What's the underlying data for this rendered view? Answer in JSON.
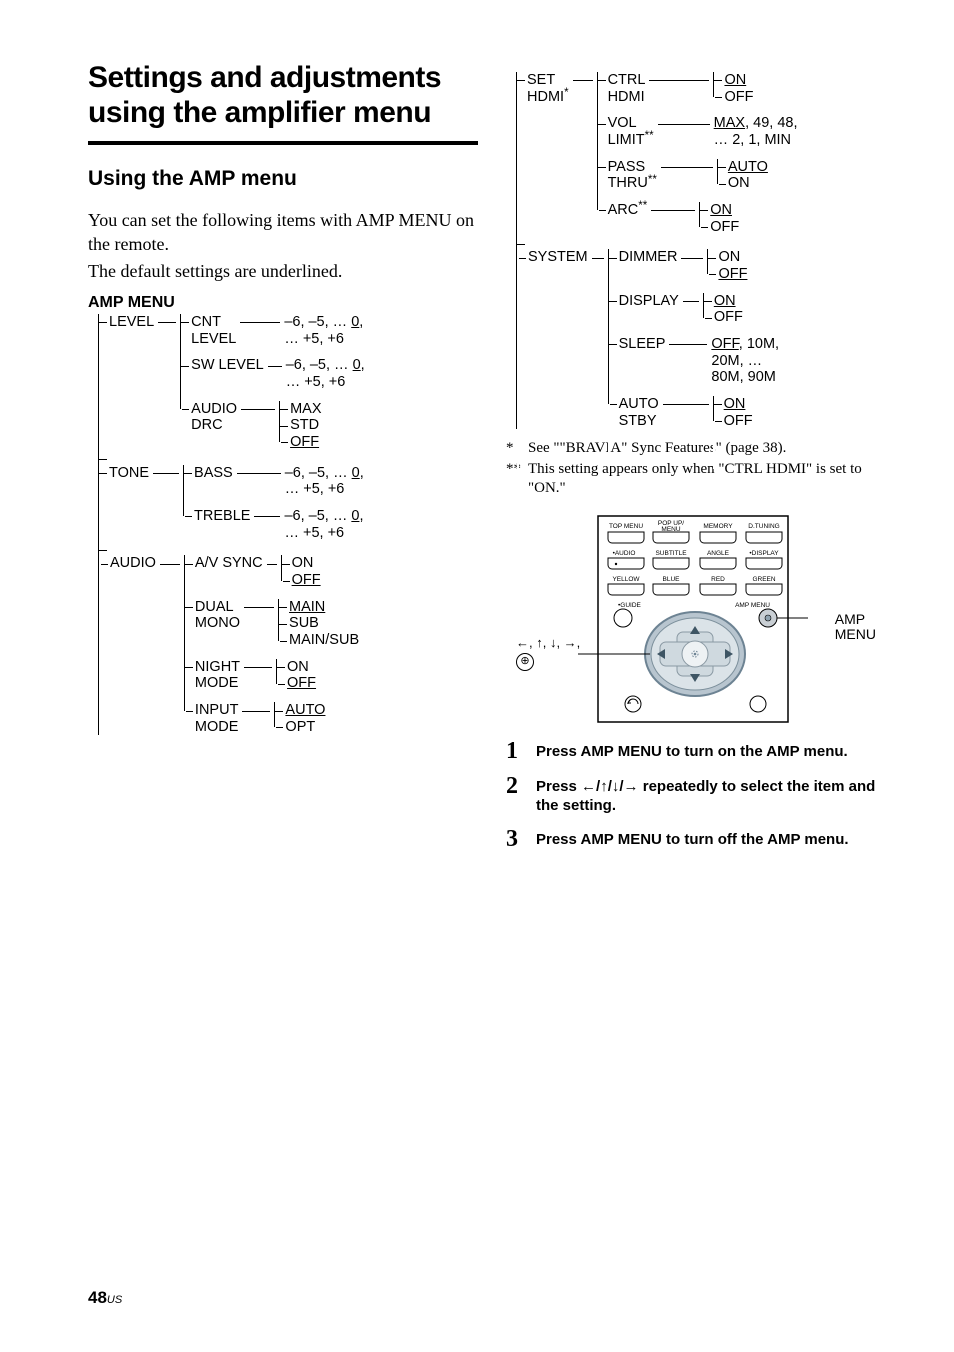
{
  "section_title_l1": "Settings and adjustments",
  "section_title_l2": "using the amplifier menu",
  "subhead": "Using the AMP menu",
  "intro_l1": "You can set the following items with AMP MENU on the remote.",
  "intro_l2": "The default settings are underlined.",
  "amp_menu_label": "AMP MENU",
  "tree": {
    "level": {
      "label": "LEVEL",
      "cnt_level_label": "CNT LEVEL",
      "cnt_level_values": "–6, –5, … 0, … +5, +6",
      "sw_level_label": "SW LEVEL",
      "sw_level_values": "–6, –5, … 0, … +5, +6",
      "audio_drc_label": "AUDIO DRC",
      "audio_drc_v_max": "MAX",
      "audio_drc_v_std": "STD",
      "audio_drc_v_off": "OFF"
    },
    "tone": {
      "label": "TONE",
      "bass_label": "BASS",
      "bass_values": "–6, –5, … 0, … +5, +6",
      "treble_label": "TREBLE",
      "treble_values": "–6, –5, … 0, … +5, +6"
    },
    "audio": {
      "label": "AUDIO",
      "av_sync_label": "A/V SYNC",
      "av_sync_on": "ON",
      "av_sync_off": "OFF",
      "dual_mono_label": "DUAL MONO",
      "dual_mono_main": "MAIN",
      "dual_mono_sub": "SUB",
      "dual_mono_mainsub": "MAIN/SUB",
      "night_mode_label": "NIGHT MODE",
      "night_on": "ON",
      "night_off": "OFF",
      "input_mode_label": "INPUT MODE",
      "input_auto": "AUTO",
      "input_opt": "OPT"
    },
    "set_hdmi": {
      "label": "SET HDMI",
      "star": "*",
      "ctrl_hdmi_label": "CTRL HDMI",
      "ctrl_on": "ON",
      "ctrl_off": "OFF",
      "vol_limit_label": "VOL LIMIT",
      "vol_limit_star": "**",
      "vol_limit_values": "MAX, 49, 48, … 2, 1, MIN",
      "pass_thru_label": "PASS THRU",
      "pass_thru_star": "**",
      "pass_auto": "AUTO",
      "pass_on": "ON",
      "arc_label": "ARC",
      "arc_star": "**",
      "arc_on": "ON",
      "arc_off": "OFF"
    },
    "system": {
      "label": "SYSTEM",
      "dimmer_label": "DIMMER",
      "dimmer_on": "ON",
      "dimmer_off": "OFF",
      "display_label": "DISPLAY",
      "display_on": "ON",
      "display_off": "OFF",
      "sleep_label": "SLEEP",
      "sleep_values": "OFF, 10M, 20M, … 80M, 90M",
      "auto_stby_label": "AUTO STBY",
      "auto_on": "ON",
      "auto_off": "OFF"
    }
  },
  "footnote1": "See \"\"BRAVIA\" Sync Features\" (page 38).",
  "footnote2": "This setting appears only when \"CTRL HDMI\" is set to \"ON.\"",
  "remote": {
    "row1": [
      "TOP MENU",
      "POP UP/\nMENU",
      "MEMORY",
      "D.TUNING"
    ],
    "row2_left": "AUDIO",
    "row2a": "SUBTITLE",
    "row2b": "ANGLE",
    "row2_right": "DISPLAY",
    "row3": [
      "YELLOW",
      "BLUE",
      "RED",
      "GREEN"
    ],
    "guide_label": "GUIDE",
    "amp_menu_label": "AMP MENU",
    "callout_amp": "AMP MENU",
    "callout_arrows_pre": "←, ↑, ↓, →,",
    "callout_enter_text": ""
  },
  "steps": {
    "s1": "Press AMP MENU to turn on the AMP menu.",
    "s2": "Press ←/↑/↓/→ repeatedly to select the item and the setting.",
    "s3": "Press AMP MENU to turn off the AMP menu."
  },
  "page_num": "48",
  "page_region": "US"
}
